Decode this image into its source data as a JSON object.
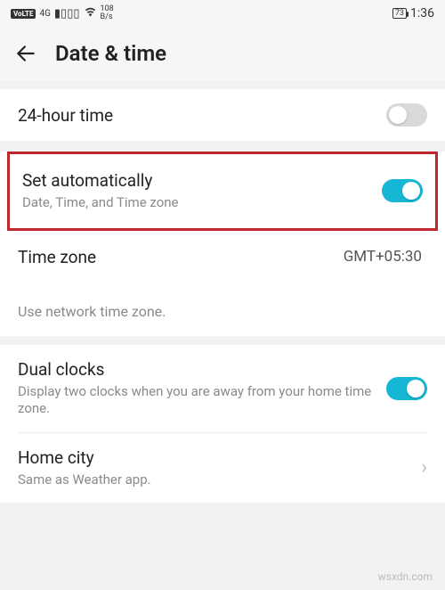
{
  "status": {
    "volte": "VoLTE",
    "net_gen": "4G",
    "netspeed_value": "108",
    "netspeed_unit": "B/s",
    "battery_pct": "73",
    "clock": "1:36"
  },
  "header": {
    "title": "Date & time"
  },
  "items": {
    "twentyfour": {
      "title": "24-hour time",
      "enabled": false
    },
    "auto": {
      "title": "Set automatically",
      "sub": "Date, Time, and Time zone",
      "enabled": true
    },
    "timezone": {
      "title": "Time zone",
      "value": "GMT+05:30"
    },
    "tz_note": "Use network time zone.",
    "dualclocks": {
      "title": "Dual clocks",
      "sub": "Display two clocks when you are away from your home time zone.",
      "enabled": true
    },
    "homecity": {
      "title": "Home city",
      "sub": "Same as Weather app."
    }
  },
  "watermark": "wsxdn.com"
}
